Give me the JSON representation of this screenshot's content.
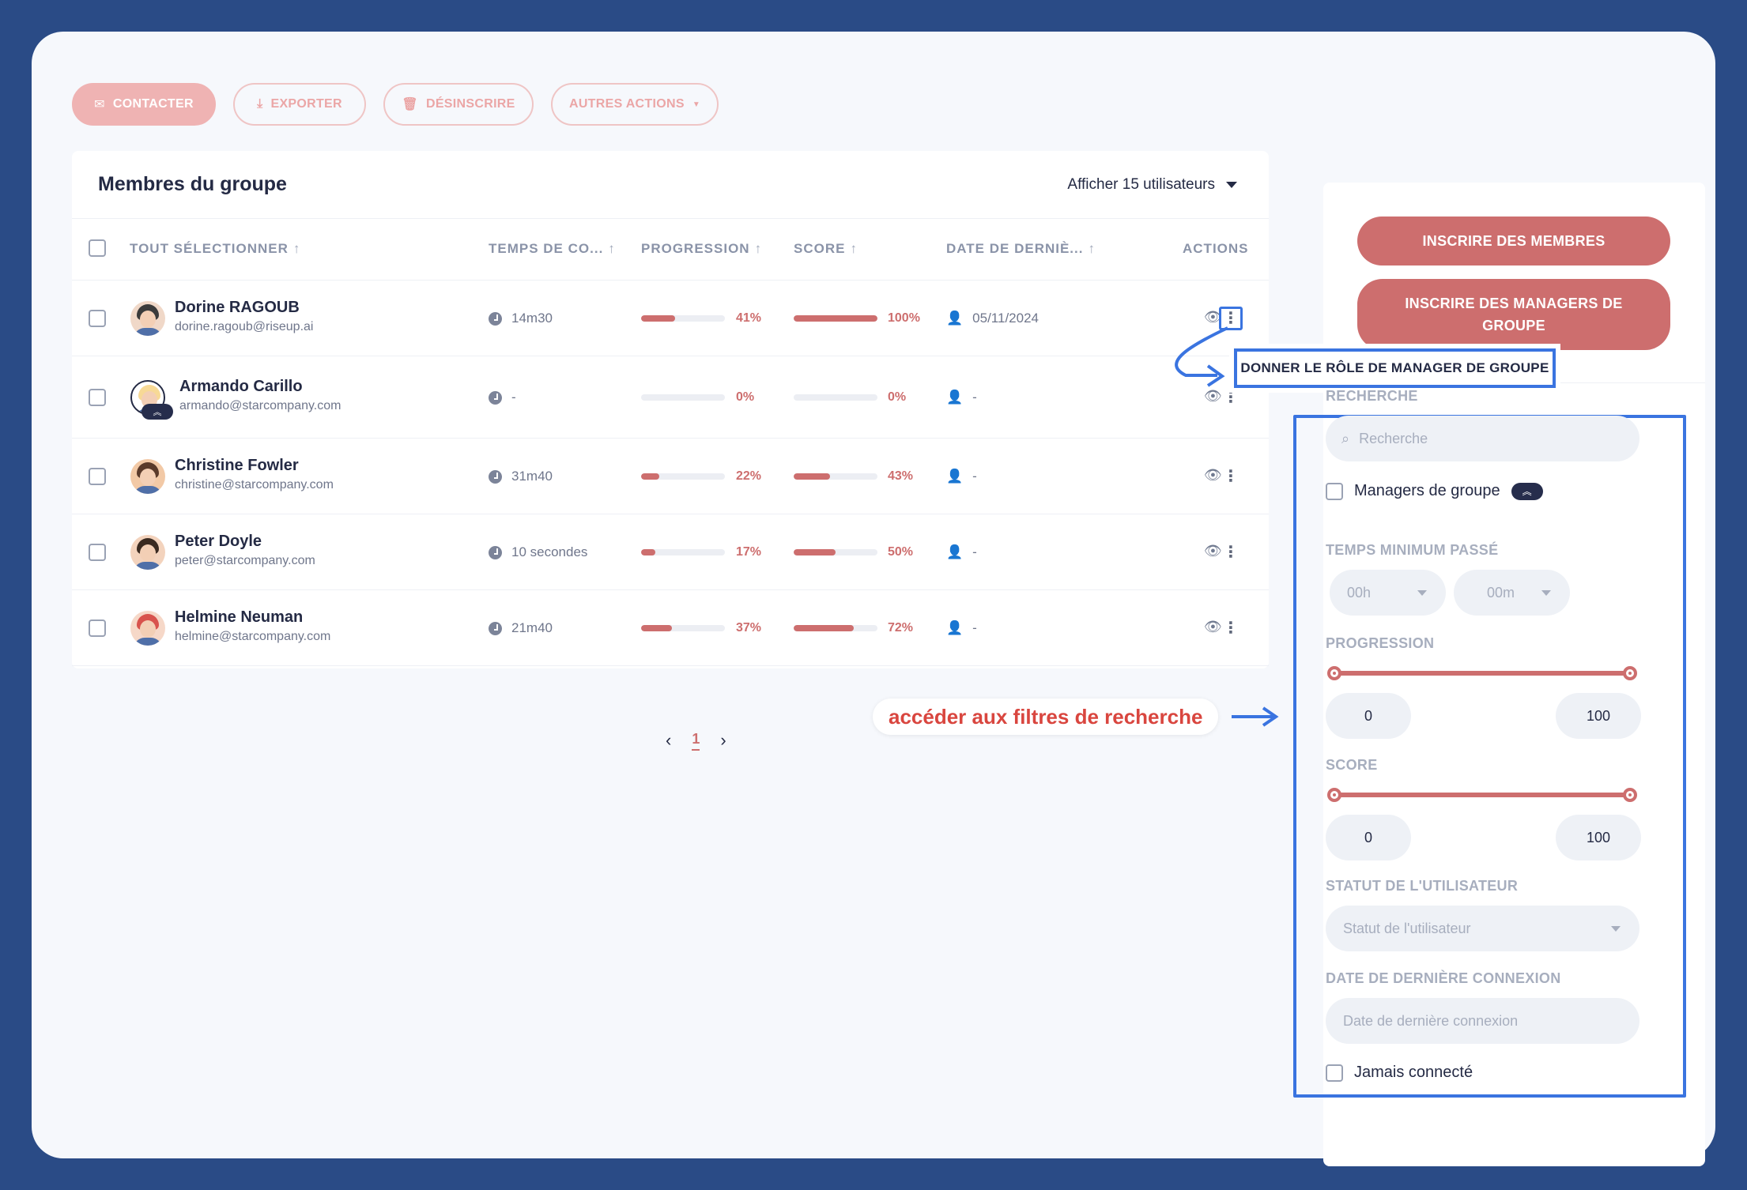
{
  "toolbar": {
    "contact": "CONTACTER",
    "export": "EXPORTER",
    "unsubscribe": "DÉSINSCRIRE",
    "other": "AUTRES ACTIONS"
  },
  "members": {
    "title": "Membres du groupe",
    "show_users": "Afficher 15 utilisateurs",
    "columns": {
      "select_all": "TOUT SÉLECTIONNER",
      "time": "TEMPS DE CO...",
      "progress": "PROGRESSION",
      "score": "SCORE",
      "last_login": "DATE DE DERNIÈ...",
      "actions": "ACTIONS"
    },
    "rows": [
      {
        "name": "Dorine RAGOUB",
        "email": "dorine.ragoub@riseup.ai",
        "time": "14m30",
        "progress": 41,
        "progress_label": "41%",
        "score": 100,
        "score_label": "100%",
        "last_login": "05/11/2024"
      },
      {
        "name": "Armando Carillo",
        "email": "armando@starcompany.com",
        "time": "-",
        "progress": 0,
        "progress_label": "0%",
        "score": 0,
        "score_label": "0%",
        "last_login": "-"
      },
      {
        "name": "Christine Fowler",
        "email": "christine@starcompany.com",
        "time": "31m40",
        "progress": 22,
        "progress_label": "22%",
        "score": 43,
        "score_label": "43%",
        "last_login": "-"
      },
      {
        "name": "Peter Doyle",
        "email": "peter@starcompany.com",
        "time": "10 secondes",
        "progress": 17,
        "progress_label": "17%",
        "score": 50,
        "score_label": "50%",
        "last_login": "-"
      },
      {
        "name": "Helmine Neuman",
        "email": "helmine@starcompany.com",
        "time": "21m40",
        "progress": 37,
        "progress_label": "37%",
        "score": 72,
        "score_label": "72%",
        "last_login": "-"
      }
    ],
    "page": "1"
  },
  "tooltip": "DONNER LE RÔLE DE MANAGER DE GROUPE",
  "hint": "accéder aux filtres de recherche",
  "side": {
    "enroll_members": "INSCRIRE DES MEMBRES",
    "enroll_managers": "INSCRIRE DES MANAGERS DE GROUPE",
    "search_label": "RECHERCHE",
    "search_placeholder": "Recherche",
    "managers_check": "Managers de groupe",
    "min_time_label": "TEMPS MINIMUM PASSÉ",
    "hours": "00h",
    "minutes": "00m",
    "progress_label": "PROGRESSION",
    "progress_min": "0",
    "progress_max": "100",
    "score_label": "SCORE",
    "score_min": "0",
    "score_max": "100",
    "status_label": "STATUT DE L'UTILISATEUR",
    "status_placeholder": "Statut de l'utilisateur",
    "last_login_label": "DATE DE DERNIÈRE CONNEXION",
    "last_login_placeholder": "Date de dernière connexion",
    "never_connected": "Jamais connecté"
  },
  "colors": {
    "accent": "#cd6e6e",
    "highlight": "#3a74e0",
    "background": "#2a4b86"
  }
}
